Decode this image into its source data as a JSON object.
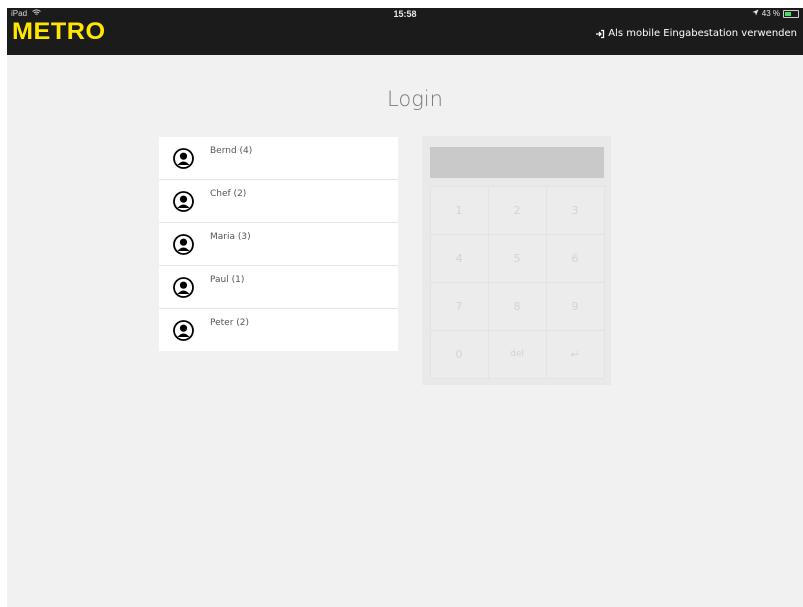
{
  "status_bar": {
    "device": "iPad",
    "time": "15:58",
    "battery": "43 %",
    "battery_level": 0.43,
    "battery_color": "#4cd964"
  },
  "header": {
    "logo": "METRO",
    "logo_color": "#ffe600",
    "mobile_station_label": "Als mobile Eingabestation verwenden",
    "mobile_station_icon": "sign-in-icon"
  },
  "page": {
    "title": "Login"
  },
  "users": [
    {
      "name": "Bernd (4)",
      "icon": "user-icon"
    },
    {
      "name": "Chef (2)",
      "icon": "user-icon"
    },
    {
      "name": "Maria (3)",
      "icon": "user-icon"
    },
    {
      "name": "Paul (1)",
      "icon": "user-icon"
    },
    {
      "name": "Peter (2)",
      "icon": "user-icon"
    }
  ],
  "keypad": {
    "pin_value": "",
    "keys": [
      "1",
      "2",
      "3",
      "4",
      "5",
      "6",
      "7",
      "8",
      "9",
      "0",
      "del",
      "↵"
    ]
  }
}
